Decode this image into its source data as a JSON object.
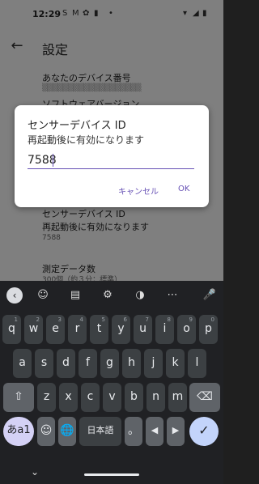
{
  "status": {
    "time": "12:29",
    "icons": [
      "s-icon",
      "m-icon",
      "flower-icon",
      "bottle-icon",
      "dot-icon"
    ],
    "right_icons": [
      "wifi-icon",
      "signal-icon",
      "battery-icon"
    ]
  },
  "appbar": {
    "title": "設定",
    "back_icon": "arrow-left-icon"
  },
  "prefs": {
    "device_number_title": "あなたのデバイス番号",
    "software_version_title": "ソフトウェアバージョン",
    "sensor_title": "センサーデバイス ID",
    "sensor_summary": "再起動後に有効になります",
    "sensor_value": "7588",
    "count_title": "測定データ数",
    "count_summary": "300個（約３分：標準）"
  },
  "dialog": {
    "title": "センサーデバイス ID",
    "message": "再起動後に有効になります",
    "input_value": "7588",
    "cancel_label": "キャンセル",
    "ok_label": "OK"
  },
  "keyboard": {
    "toolbar": [
      "chevron-left-icon",
      "sticker-icon",
      "clipboard-icon",
      "gear-icon",
      "palette-icon",
      "more-icon",
      "mic-icon"
    ],
    "row1": [
      {
        "k": "q",
        "h": "1"
      },
      {
        "k": "w",
        "h": "2"
      },
      {
        "k": "e",
        "h": "3"
      },
      {
        "k": "r",
        "h": "4"
      },
      {
        "k": "t",
        "h": "5"
      },
      {
        "k": "y",
        "h": "6"
      },
      {
        "k": "u",
        "h": "7"
      },
      {
        "k": "i",
        "h": "8"
      },
      {
        "k": "o",
        "h": "9"
      },
      {
        "k": "p",
        "h": "0"
      }
    ],
    "row2": [
      "a",
      "s",
      "d",
      "f",
      "g",
      "h",
      "j",
      "k",
      "l"
    ],
    "row3": [
      "z",
      "x",
      "c",
      "v",
      "b",
      "n",
      "m"
    ],
    "symbol_key": "あa1",
    "emoji_key": "☺",
    "globe_key": "🌐",
    "space_label": "日本語",
    "period_key": "。",
    "left_key": "◀",
    "right_key": "▶",
    "enter_key": "✓",
    "shift_key": "⇧",
    "delete_key": "⌫"
  },
  "nav": {
    "back_icon": "chevron-down-icon"
  }
}
